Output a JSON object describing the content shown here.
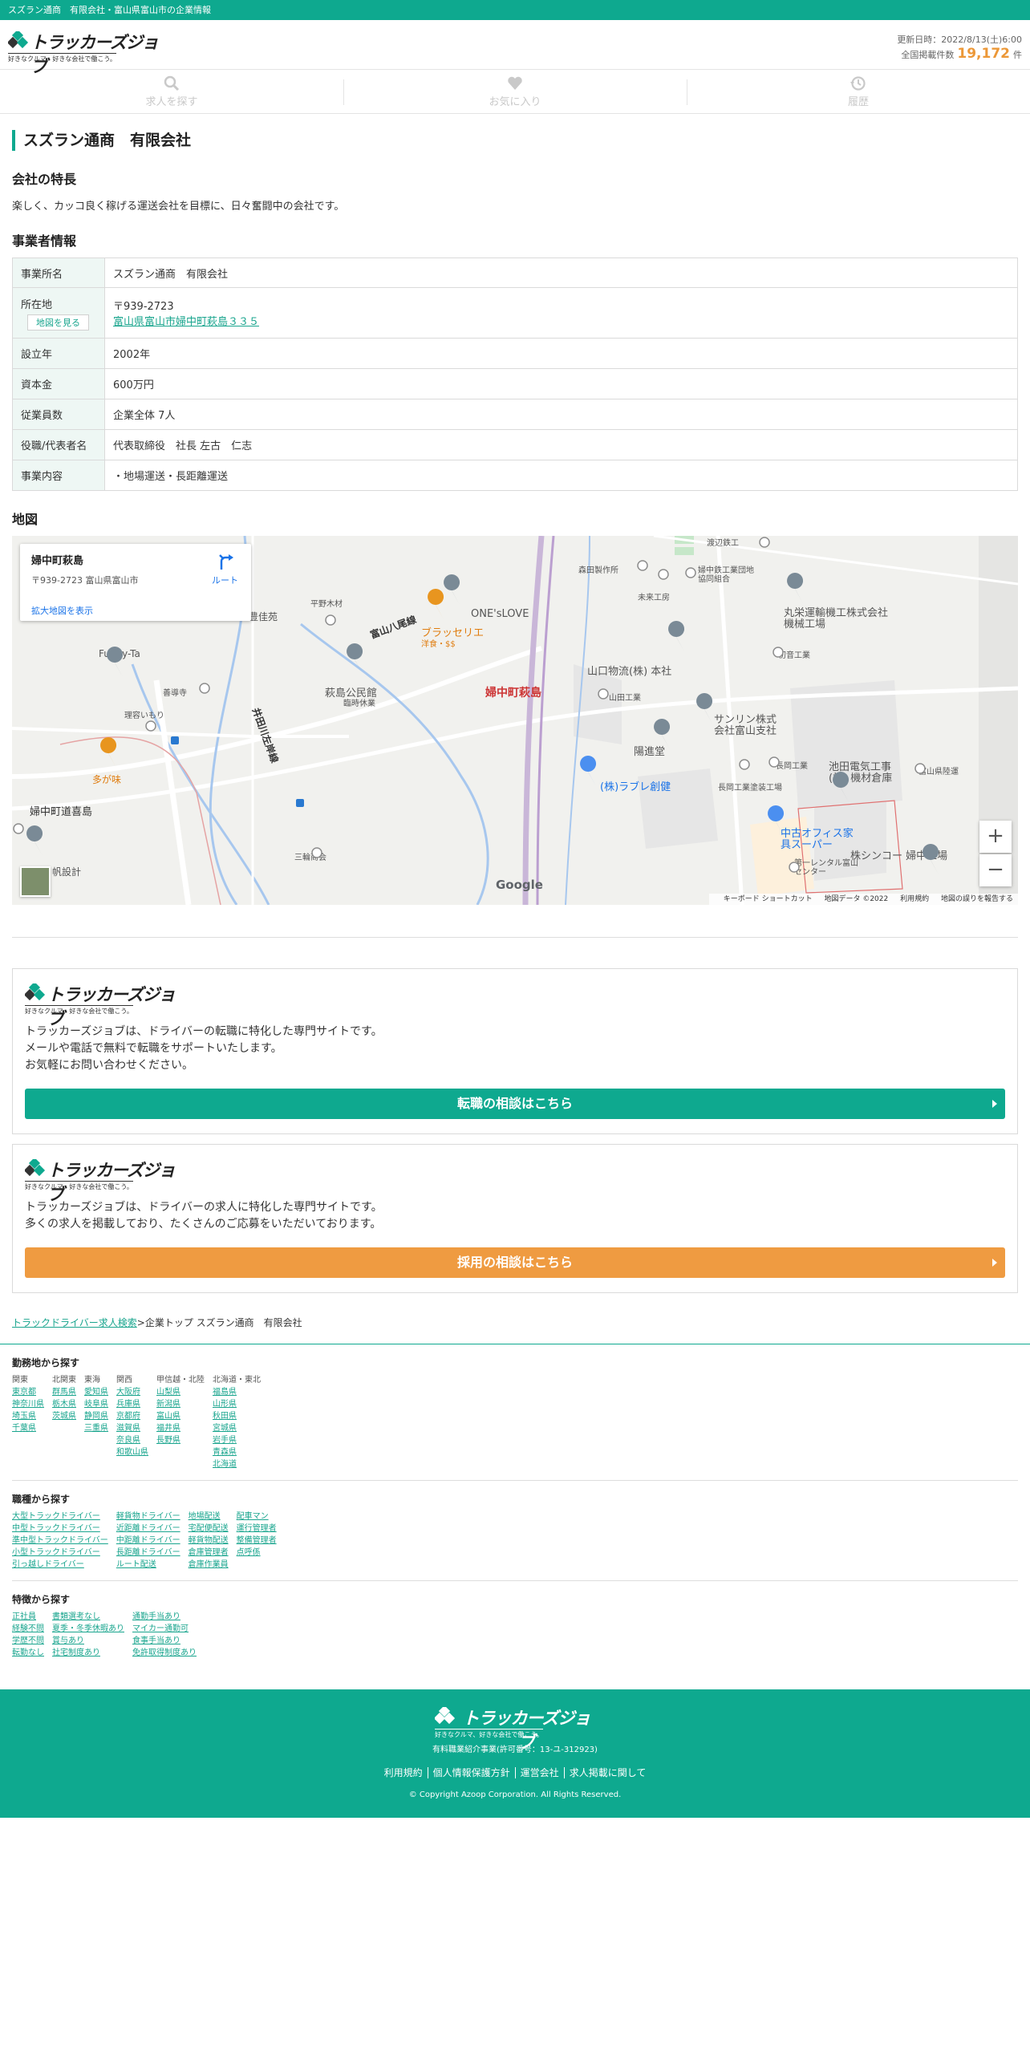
{
  "topbar": {
    "text": "スズラン通商　有限会社・富山県富山市の企業情報"
  },
  "logo": {
    "text": "トラッカーズジョブ",
    "tagline": "好きなクルマ、好きな会社で働こう。"
  },
  "header": {
    "updated": "更新日時：2022/8/13(土)6:00",
    "count_label": "全国掲載件数",
    "count": "19,172",
    "count_unit": "件"
  },
  "tabs": [
    {
      "label": "求人を探す",
      "icon": "search-icon"
    },
    {
      "label": "お気に入り",
      "icon": "heart-icon"
    },
    {
      "label": "履歴",
      "icon": "history-icon"
    }
  ],
  "company": {
    "name": "スズラン通商　有限会社",
    "feature_heading": "会社の特長",
    "feature_text": "楽しく、カッコ良く稼げる運送会社を目標に、日々奮闘中の会社です。",
    "info_heading": "事業者情報",
    "rows": {
      "office_label": "事業所名",
      "office_value": "スズラン通商　有限会社",
      "address_label": "所在地",
      "map_button": "地図を見る",
      "postal": "〒939-2723",
      "address": "富山県富山市婦中町萩島３３５",
      "founded_label": "設立年",
      "founded_value": "2002年",
      "capital_label": "資本金",
      "capital_value": "600万円",
      "employees_label": "従業員数",
      "employees_value": "企業全体 7人",
      "rep_label": "役職/代表者名",
      "rep_value": "代表取締役　社長 左古　仁志",
      "business_label": "事業内容",
      "business_value": "・地場運送・長距離運送"
    }
  },
  "map": {
    "heading": "地図",
    "card_name": "婦中町萩島",
    "card_address": "〒939-2723 富山県富山市",
    "card_enlarge": "拡大地図を表示",
    "card_route": "ルート",
    "labels": {
      "l1": "婦中町萩島",
      "l2": "富山八尾線",
      "l3": "ブラッセリエ",
      "l3b": "洋食・$$",
      "l4": "萩島公民館",
      "l4b": "臨時休業",
      "l5": "山口物流(株) 本社",
      "l6": "丸栄運輸機工株式会社 機械工場",
      "l7": "サンリン株式会社富山支社",
      "l8": "陽進堂",
      "l9": "(株)ラブレ創健",
      "l10": "池田電気工事(株) 機材倉庫",
      "l11": "中古オフィス家具スーパー",
      "l12": "株シンコー 婦中工場",
      "l13": "婦中町道喜島",
      "l14": "多が味",
      "l15": "Funny-Ta",
      "l16": "井田川左岸線",
      "l17": "三輪商会",
      "l18": "帆設計",
      "l19": "豊佳苑",
      "l20": "平野木材",
      "l21": "森田製作所",
      "l22": "未来工房",
      "l23": "婦中鉄工業団地協同組合",
      "l24": "初音工業",
      "l25": "山田工業",
      "l26": "長岡工業",
      "l27": "長岡工業塗装工場",
      "l28": "第一レンタル富山センター",
      "l29": "富山県陸運",
      "l30": "渡辺鉄工",
      "l31": "善導寺",
      "l32": "理容いもり",
      "l33": "ONE'sLOVE"
    },
    "footer": {
      "shortcuts": "キーボード ショートカット",
      "mapdata": "地図データ ©2022",
      "terms": "利用規約",
      "report": "地図の誤りを報告する"
    },
    "google": "Google",
    "zoom_in": "+",
    "zoom_out": "−"
  },
  "promos": [
    {
      "text1": "トラッカーズジョブは、ドライバーの転職に特化した専門サイトです。",
      "text2": "メールや電話で無料で転職をサポートいたします。",
      "text3": "お気軽にお問い合わせください。",
      "cta": "転職の相談はこちら",
      "color": "#0ea98f"
    },
    {
      "text1": "トラッカーズジョブは、ドライバーの求人に特化した専門サイトです。",
      "text2": "多くの求人を掲載しており、たくさんのご応募をいただいております。",
      "cta": "採用の相談はこちら",
      "color": "#ef9b41"
    }
  ],
  "breadcrumb": {
    "link": "トラックドライバー求人検索",
    "rest": ">企業トップ スズラン通商　有限会社"
  },
  "search_area": {
    "heading": "勤務地から探す",
    "cols": [
      {
        "head": "関東",
        "items": [
          "東京都",
          "神奈川県",
          "埼玉県",
          "千葉県"
        ]
      },
      {
        "head": "北関東",
        "items": [
          "群馬県",
          "栃木県",
          "茨城県"
        ]
      },
      {
        "head": "東海",
        "items": [
          "愛知県",
          "岐阜県",
          "静岡県",
          "三重県"
        ]
      },
      {
        "head": "関西",
        "items": [
          "大阪府",
          "兵庫県",
          "京都府",
          "滋賀県",
          "奈良県",
          "和歌山県"
        ]
      },
      {
        "head": "甲信越・北陸",
        "items": [
          "山梨県",
          "新潟県",
          "富山県",
          "福井県",
          "長野県"
        ]
      },
      {
        "head": "北海道・東北",
        "items": [
          "福島県",
          "山形県",
          "秋田県",
          "宮城県",
          "岩手県",
          "青森県",
          "北海道"
        ]
      }
    ]
  },
  "search_job": {
    "heading": "職種から探す",
    "cols": [
      {
        "items": [
          "大型トラックドライバー",
          "中型トラックドライバー",
          "準中型トラックドライバー",
          "小型トラックドライバー",
          "引っ越しドライバー"
        ]
      },
      {
        "items": [
          "軽貨物ドライバー",
          "近距離ドライバー",
          "中距離ドライバー",
          "長距離ドライバー",
          "ルート配送"
        ]
      },
      {
        "items": [
          "地場配送",
          "宅配便配送",
          "軽貨物配送",
          "倉庫管理者",
          "倉庫作業員"
        ]
      },
      {
        "items": [
          "配車マン",
          "運行管理者",
          "整備管理者",
          "点呼係"
        ]
      }
    ]
  },
  "search_feature": {
    "heading": "特徴から探す",
    "cols": [
      {
        "items": [
          "正社員",
          "経験不問",
          "学歴不問",
          "転勤なし"
        ]
      },
      {
        "items": [
          "書類選考なし",
          "夏季・冬季休暇あり",
          "賞与あり",
          "社宅制度あり"
        ]
      },
      {
        "items": [
          "通勤手当あり",
          "マイカー通勤可",
          "食事手当あり",
          "免許取得制度あり"
        ]
      }
    ]
  },
  "footer": {
    "license": "有料職業紹介事業(許可番号：13-ユ-312923)",
    "links": [
      "利用規約",
      "個人情報保護方針",
      "運営会社",
      "求人掲載に関して"
    ],
    "copyright": "© Copyright Azoop Corporation. All Rights Reserved."
  }
}
